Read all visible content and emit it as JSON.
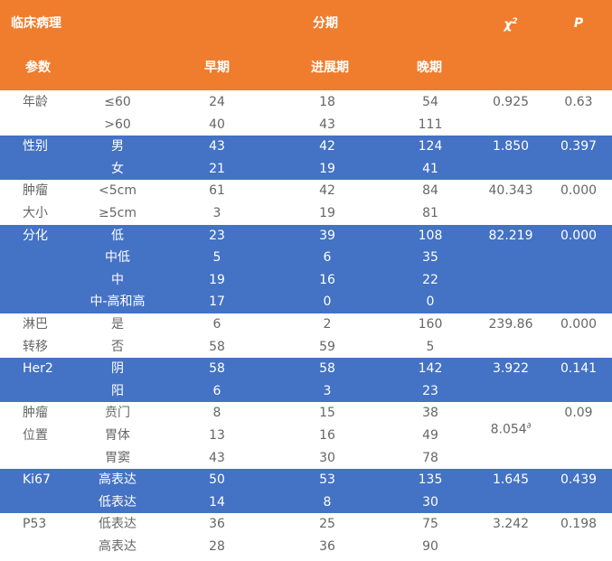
{
  "colors": {
    "header": "#ef7d2d",
    "band": "#4472c4",
    "text": "#666666",
    "header_text": "#ffffff"
  },
  "header": {
    "col_clinical": "临床病理",
    "col_stage": "分期",
    "col_chi_main": "χ",
    "col_chi_sup": "2",
    "col_p": "P",
    "col_param": "参数",
    "stage_early": "早期",
    "stage_progress": "进展期",
    "stage_late": "晚期"
  },
  "groups": [
    {
      "param_lines": [
        "年龄"
      ],
      "band": false,
      "chi": "0.925",
      "chi_mark": "",
      "p": "0.63",
      "rows": [
        {
          "label": "≤60",
          "early": "24",
          "progress": "18",
          "late": "54"
        },
        {
          "label": ">60",
          "early": "40",
          "progress": "43",
          "late": "111"
        }
      ]
    },
    {
      "param_lines": [
        "性别"
      ],
      "band": true,
      "chi": "1.850",
      "chi_mark": "",
      "p": "0.397",
      "rows": [
        {
          "label": "男",
          "early": "43",
          "progress": "42",
          "late": "124"
        },
        {
          "label": "女",
          "early": "21",
          "progress": "19",
          "late": "41"
        }
      ]
    },
    {
      "param_lines": [
        "肿瘤",
        "大小"
      ],
      "band": false,
      "chi": "40.343",
      "chi_mark": "",
      "p": "0.000",
      "rows": [
        {
          "label": "<5cm",
          "early": "61",
          "progress": "42",
          "late": "84"
        },
        {
          "label": "≥5cm",
          "early": "3",
          "progress": "19",
          "late": "81"
        }
      ]
    },
    {
      "param_lines": [
        "分化"
      ],
      "band": true,
      "chi": "82.219",
      "chi_mark": "",
      "p": "0.000",
      "rows": [
        {
          "label": "低",
          "early": "23",
          "progress": "39",
          "late": "108"
        },
        {
          "label": "中低",
          "early": "5",
          "progress": "6",
          "late": "35"
        },
        {
          "label": "中",
          "early": "19",
          "progress": "16",
          "late": "22"
        },
        {
          "label": "中-高和高",
          "early": "17",
          "progress": "0",
          "late": "0"
        }
      ]
    },
    {
      "param_lines": [
        "淋巴",
        "转移"
      ],
      "band": false,
      "chi": "239.86",
      "chi_mark": "",
      "p": "0.000",
      "rows": [
        {
          "label": "是",
          "early": "6",
          "progress": "2",
          "late": "160"
        },
        {
          "label": "否",
          "early": "58",
          "progress": "59",
          "late": "5"
        }
      ]
    },
    {
      "param_lines": [
        "Her2"
      ],
      "band": true,
      "chi": "3.922",
      "chi_mark": "",
      "p": "0.141",
      "rows": [
        {
          "label": "阴",
          "early": "58",
          "progress": "58",
          "late": "142"
        },
        {
          "label": "阳",
          "early": "6",
          "progress": "3",
          "late": "23"
        }
      ]
    },
    {
      "param_lines": [
        "肿瘤",
        "位置"
      ],
      "band": false,
      "chi": "8.054",
      "chi_mark": "∂",
      "p": "0.09",
      "rows": [
        {
          "label": "贲门",
          "early": "8",
          "progress": "15",
          "late": "38"
        },
        {
          "label": "胃体",
          "early": "13",
          "progress": "16",
          "late": "49"
        },
        {
          "label": "胃窦",
          "early": "43",
          "progress": "30",
          "late": "78"
        }
      ]
    },
    {
      "param_lines": [
        "Ki67"
      ],
      "band": true,
      "chi": "1.645",
      "chi_mark": "",
      "p": "0.439",
      "rows": [
        {
          "label": "高表达",
          "early": "50",
          "progress": "53",
          "late": "135"
        },
        {
          "label": "低表达",
          "early": "14",
          "progress": "8",
          "late": "30"
        }
      ]
    },
    {
      "param_lines": [
        "P53"
      ],
      "band": false,
      "chi": "3.242",
      "chi_mark": "",
      "p": "0.198",
      "rows": [
        {
          "label": "低表达",
          "early": "36",
          "progress": "25",
          "late": "75"
        },
        {
          "label": "高表达",
          "early": "28",
          "progress": "36",
          "late": "90"
        }
      ]
    }
  ]
}
